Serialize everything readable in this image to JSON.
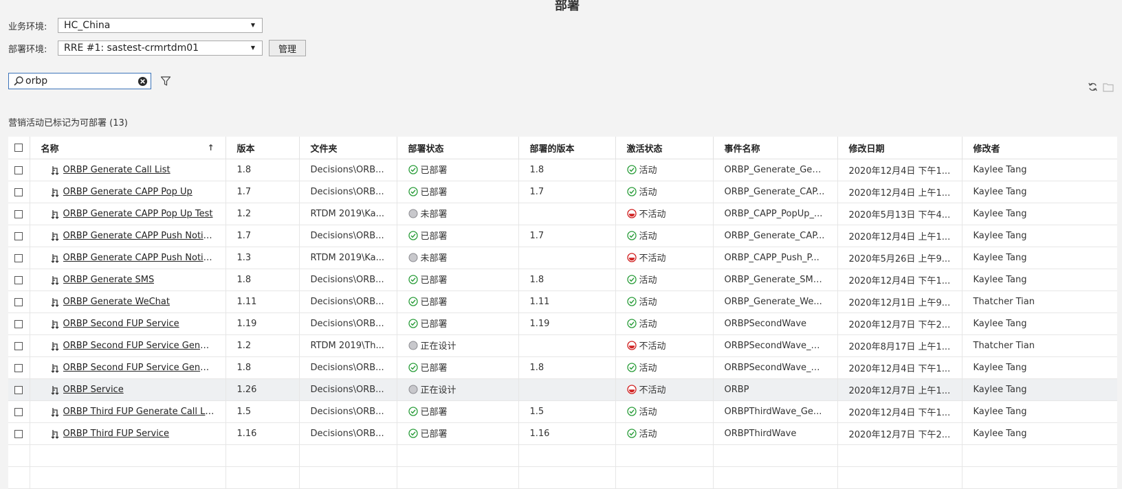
{
  "page": {
    "title": "部署"
  },
  "form": {
    "business_env_label": "业务环境:",
    "business_env_value": "HC_China",
    "deploy_env_label": "部署环境:",
    "deploy_env_value": "RRE #1: sastest-crmrtdm01",
    "manage_label": "管理"
  },
  "search": {
    "value": "orbp"
  },
  "count_label": "营销活动已标记为可部署 (13)",
  "columns": {
    "name": "名称",
    "version": "版本",
    "folder": "文件夹",
    "deploy_status": "部署状态",
    "deployed_version": "部署的版本",
    "active_status": "激活状态",
    "event_name": "事件名称",
    "modified_date": "修改日期",
    "modifier": "修改者"
  },
  "rows": [
    {
      "name": "ORBP Generate Call List",
      "version": "1.8",
      "folder": "Decisions\\ORB...",
      "deploy_status": "已部署",
      "deploy_state": "deployed",
      "deployed_version": "1.8",
      "active": "活动",
      "active_state": "active",
      "event": "ORBP_Generate_Gen...",
      "date": "2020年12月4日 下午1...",
      "modifier": "Kaylee Tang"
    },
    {
      "name": "ORBP Generate CAPP Pop Up",
      "version": "1.7",
      "folder": "Decisions\\ORB...",
      "deploy_status": "已部署",
      "deploy_state": "deployed",
      "deployed_version": "1.7",
      "active": "活动",
      "active_state": "active",
      "event": "ORBP_Generate_CAP...",
      "date": "2020年12月4日 上午1...",
      "modifier": "Kaylee Tang"
    },
    {
      "name": "ORBP Generate CAPP Pop Up Test",
      "version": "1.2",
      "folder": "RTDM 2019\\Ka...",
      "deploy_status": "未部署",
      "deploy_state": "none",
      "deployed_version": "",
      "active": "不活动",
      "active_state": "inactive",
      "event": "ORBP_CAPP_PopUp_...",
      "date": "2020年5月13日 下午4...",
      "modifier": "Kaylee Tang"
    },
    {
      "name": "ORBP Generate CAPP Push Notifi...",
      "version": "1.7",
      "folder": "Decisions\\ORB...",
      "deploy_status": "已部署",
      "deploy_state": "deployed",
      "deployed_version": "1.7",
      "active": "活动",
      "active_state": "active",
      "event": "ORBP_Generate_CAP...",
      "date": "2020年12月4日 上午1...",
      "modifier": "Kaylee Tang"
    },
    {
      "name": "ORBP Generate CAPP Push Notifi...",
      "version": "1.3",
      "folder": "RTDM 2019\\Ka...",
      "deploy_status": "未部署",
      "deploy_state": "none",
      "deployed_version": "",
      "active": "不活动",
      "active_state": "inactive",
      "event": "ORBP_CAPP_Push_P...",
      "date": "2020年5月26日 上午9...",
      "modifier": "Kaylee Tang"
    },
    {
      "name": "ORBP Generate SMS",
      "version": "1.8",
      "folder": "Decisions\\ORB...",
      "deploy_status": "已部署",
      "deploy_state": "deployed",
      "deployed_version": "1.8",
      "active": "活动",
      "active_state": "active",
      "event": "ORBP_Generate_SMS...",
      "date": "2020年12月4日 下午1...",
      "modifier": "Kaylee Tang"
    },
    {
      "name": "ORBP Generate WeChat",
      "version": "1.11",
      "folder": "Decisions\\ORB...",
      "deploy_status": "已部署",
      "deploy_state": "deployed",
      "deployed_version": "1.11",
      "active": "活动",
      "active_state": "active",
      "event": "ORBP_Generate_We...",
      "date": "2020年12月1日 上午9...",
      "modifier": "Thatcher Tian"
    },
    {
      "name": "ORBP Second FUP Service",
      "version": "1.19",
      "folder": "Decisions\\ORB...",
      "deploy_status": "已部署",
      "deploy_state": "deployed",
      "deployed_version": "1.19",
      "active": "活动",
      "active_state": "active",
      "event": "ORBPSecondWave",
      "date": "2020年12月7日 下午2...",
      "modifier": "Kaylee Tang"
    },
    {
      "name": "ORBP Second FUP Service Gener...",
      "version": "1.2",
      "folder": "RTDM 2019\\Th...",
      "deploy_status": "正在设计",
      "deploy_state": "none",
      "deployed_version": "",
      "active": "不活动",
      "active_state": "inactive",
      "event": "ORBPSecondWave_G...",
      "date": "2020年8月17日 上午1...",
      "modifier": "Thatcher Tian"
    },
    {
      "name": "ORBP Second FUP Service Gener...",
      "version": "1.8",
      "folder": "Decisions\\ORB...",
      "deploy_status": "已部署",
      "deploy_state": "deployed",
      "deployed_version": "1.8",
      "active": "活动",
      "active_state": "active",
      "event": "ORBPSecondWave_G...",
      "date": "2020年12月4日 下午1...",
      "modifier": "Kaylee Tang"
    },
    {
      "name": "ORBP Service",
      "version": "1.26",
      "folder": "Decisions\\ORB...",
      "deploy_status": "正在设计",
      "deploy_state": "none",
      "deployed_version": "",
      "active": "不活动",
      "active_state": "inactive",
      "event": "ORBP",
      "date": "2020年12月7日 上午1...",
      "modifier": "Kaylee Tang",
      "highlight": true
    },
    {
      "name": "ORBP Third FUP Generate Call List",
      "version": "1.5",
      "folder": "Decisions\\ORB...",
      "deploy_status": "已部署",
      "deploy_state": "deployed",
      "deployed_version": "1.5",
      "active": "活动",
      "active_state": "active",
      "event": "ORBPThirdWave_Ge...",
      "date": "2020年12月4日 下午1...",
      "modifier": "Kaylee Tang"
    },
    {
      "name": "ORBP Third FUP Service",
      "version": "1.16",
      "folder": "Decisions\\ORB...",
      "deploy_status": "已部署",
      "deploy_state": "deployed",
      "deployed_version": "1.16",
      "active": "活动",
      "active_state": "active",
      "event": "ORBPThirdWave",
      "date": "2020年12月7日 下午2...",
      "modifier": "Kaylee Tang"
    }
  ],
  "empty_rows": 2,
  "colors": {
    "accent_border": "#3b73b9",
    "status_ok": "#2a9d3a",
    "status_inactive": "#d02020",
    "status_pending": "#c8c8cc",
    "row_highlight": "#eef0f2"
  },
  "icons": {
    "search": "search-icon",
    "clear": "clear-icon",
    "filter": "filter-icon",
    "refresh": "refresh-icon",
    "folder": "folder-icon",
    "flow": "flow-icon",
    "sort": "sort-ascending-icon",
    "caret": "chevron-down-icon"
  }
}
